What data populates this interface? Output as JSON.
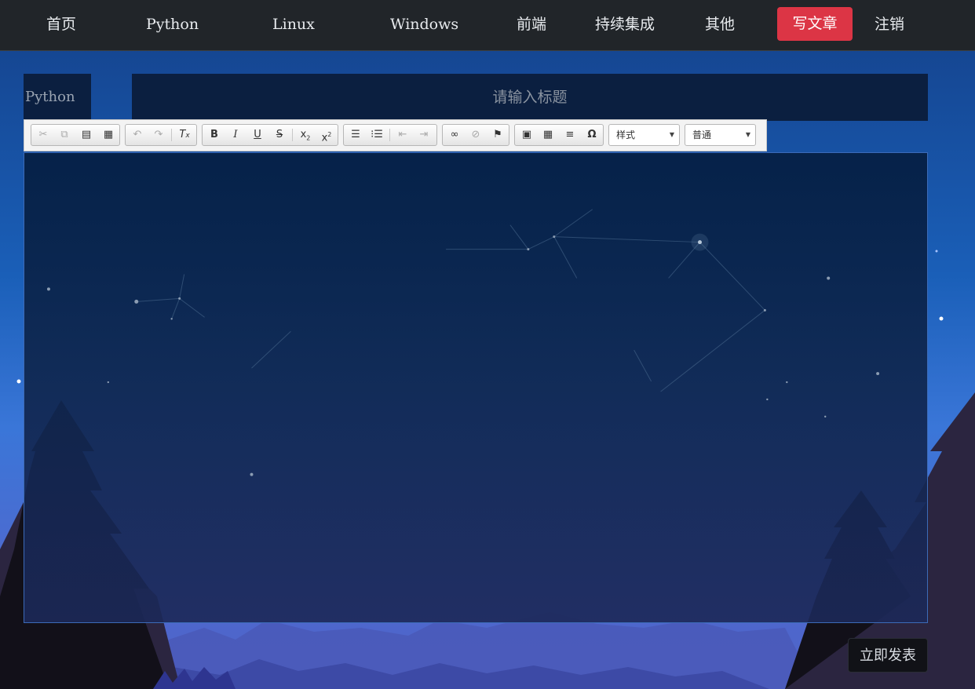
{
  "nav": {
    "items": [
      {
        "label": "首页"
      },
      {
        "label": "Python"
      },
      {
        "label": "Linux"
      },
      {
        "label": "Windows"
      },
      {
        "label": "前端"
      },
      {
        "label": "持续集成"
      },
      {
        "label": "其他"
      }
    ],
    "write_label": "写文章",
    "logout_label": "注销",
    "write_color": "#dc3545"
  },
  "form": {
    "category_value": "Python",
    "title_placeholder": "请输入标题"
  },
  "toolbar": {
    "style_combo": "样式",
    "format_combo": "普通",
    "icons": [
      "cut-icon",
      "copy-icon",
      "paste-icon",
      "paste-text-icon",
      "undo-icon",
      "redo-icon",
      "remove-format-icon",
      "bold-icon",
      "italic-icon",
      "underline-icon",
      "strikethrough-icon",
      "subscript-icon",
      "superscript-icon",
      "numbered-list-icon",
      "bulleted-list-icon",
      "outdent-icon",
      "indent-icon",
      "link-icon",
      "unlink-icon",
      "anchor-icon",
      "image-icon",
      "table-icon",
      "horizontal-rule-icon",
      "special-char-icon"
    ]
  },
  "publish_label": "立即发表",
  "colors": {
    "navbar": "#212529",
    "input_bg": "#0b1f40",
    "publish_bg": "#111217"
  }
}
